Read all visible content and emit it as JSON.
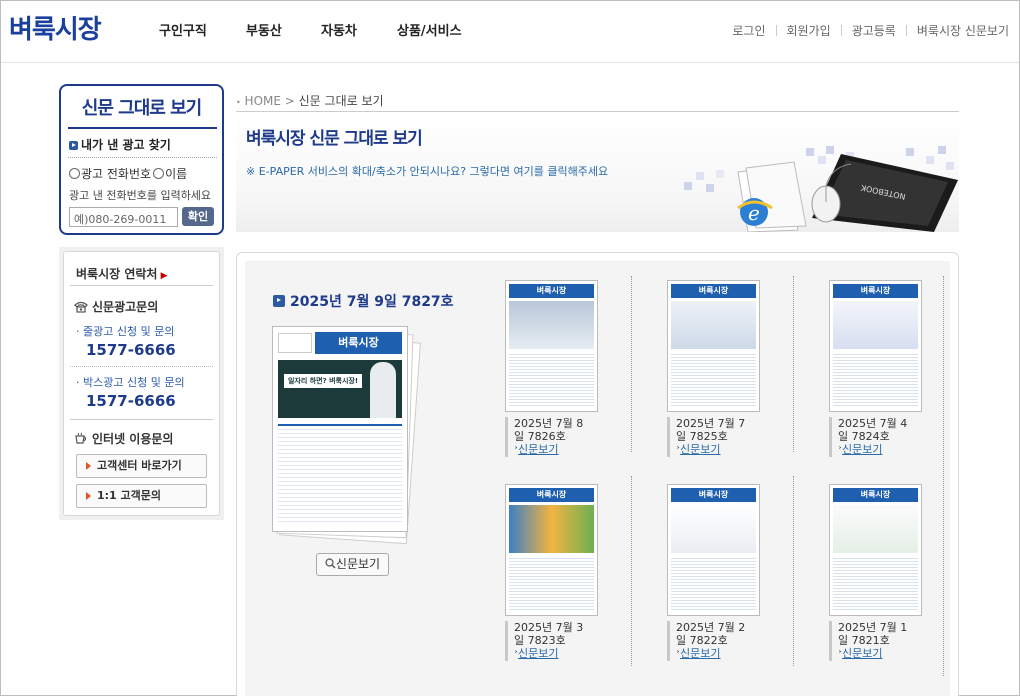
{
  "header": {
    "logo": "벼룩시장",
    "nav": [
      "구인구직",
      "부동산",
      "자동차",
      "상품/서비스"
    ],
    "util": [
      "로그인",
      "회원가입",
      "광고등록",
      "벼룩시장 신문보기"
    ]
  },
  "leftbox": {
    "title": "신문 그대로 보기",
    "subtitle": "내가 낸 광고 찾기",
    "radio1": "광고 전화번호",
    "radio2": "이름",
    "hint": "광고 낸 전화번호를 입력하세요",
    "input_value": "예)080-269-0011",
    "ok_label": "확인"
  },
  "contact": {
    "title": "벼룩시장 연락처",
    "sec1": "신문광고문의",
    "item1": "줄광고 신청 및 문의",
    "num1": "1577-6666",
    "item2": "박스광고 신청 및 문의",
    "num2": "1577-6666",
    "sec2": "인터넷 이용문의",
    "btn1": "고객센터 바로가기",
    "btn2": "1:1 고객문의"
  },
  "breadcrumb": {
    "home": "HOME",
    "current": "신문 그대로 보기"
  },
  "banner": {
    "title": "벼룩시장 신문 그대로 보기",
    "subtitle": "※ E-PAPER 서비스의 확대/축소가 안되시나요? 그렇다면 여기를 클릭해주세요",
    "notebook_label": "NOTEBOOK"
  },
  "latest": {
    "title": "2025년 7월 9일 7827호",
    "view_label": "신문보기",
    "paper_name": "벼룩시장",
    "headline": "일자리 하면? 벼룩시장!"
  },
  "issues": [
    {
      "line1": "2025년 7월 8",
      "line2": "일 7826호",
      "link": "신문보기"
    },
    {
      "line1": "2025년 7월 7",
      "line2": "일 7825호",
      "link": "신문보기"
    },
    {
      "line1": "2025년 7월 4",
      "line2": "일 7824호",
      "link": "신문보기"
    },
    {
      "line1": "2025년 7월 3",
      "line2": "일 7823호",
      "link": "신문보기"
    },
    {
      "line1": "2025년 7월 2",
      "line2": "일 7822호",
      "link": "신문보기"
    },
    {
      "line1": "2025년 7월 1",
      "line2": "일 7821호",
      "link": "신문보기"
    }
  ],
  "colors": {
    "brand": "#1e3a8a",
    "link": "#2b6aa8",
    "paper_blue": "#1f5fb0"
  }
}
